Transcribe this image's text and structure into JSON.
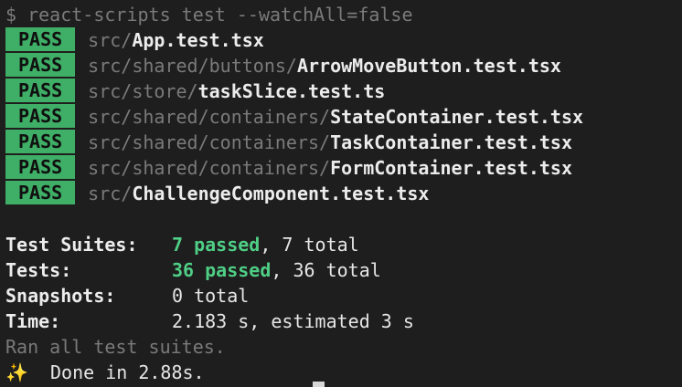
{
  "command": "$ react-scripts test --watchAll=false",
  "pass_label": "PASS",
  "results": [
    {
      "dir": "src/",
      "file": "App.test.tsx"
    },
    {
      "dir": "src/shared/buttons/",
      "file": "ArrowMoveButton.test.tsx"
    },
    {
      "dir": "src/store/",
      "file": "taskSlice.test.ts"
    },
    {
      "dir": "src/shared/containers/",
      "file": "StateContainer.test.tsx"
    },
    {
      "dir": "src/shared/containers/",
      "file": "TaskContainer.test.tsx"
    },
    {
      "dir": "src/shared/containers/",
      "file": "FormContainer.test.tsx"
    },
    {
      "dir": "src/",
      "file": "ChallengeComponent.test.tsx"
    }
  ],
  "summary": {
    "suites_label": "Test Suites:",
    "suites_passed": "7 passed",
    "suites_total": ", 7 total",
    "tests_label": "Tests:",
    "tests_passed": "36 passed",
    "tests_total": ", 36 total",
    "snapshots_label": "Snapshots:",
    "snapshots_value": "0 total",
    "time_label": "Time:",
    "time_value": "2.183 s, estimated 3 s"
  },
  "ran_all": "Ran all test suites.",
  "done_icon": "✨",
  "done_text": "Done in 2.88s."
}
